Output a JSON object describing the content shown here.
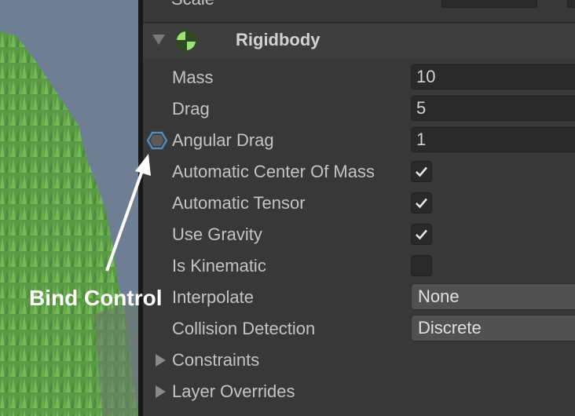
{
  "inspector": {
    "top_row_label": "Scale",
    "component": {
      "title": "Rigidbody",
      "icon": "rigidbody-icon"
    },
    "properties": [
      {
        "label": "Mass",
        "kind": "number",
        "value": "10"
      },
      {
        "label": "Drag",
        "kind": "number",
        "value": "5"
      },
      {
        "label": "Angular Drag",
        "kind": "number",
        "value": "1",
        "bound": true
      },
      {
        "label": "Automatic Center Of Mass",
        "kind": "checkbox",
        "checked": true
      },
      {
        "label": "Automatic Tensor",
        "kind": "checkbox",
        "checked": true
      },
      {
        "label": "Use Gravity",
        "kind": "checkbox",
        "checked": true
      },
      {
        "label": "Is Kinematic",
        "kind": "checkbox",
        "checked": false
      },
      {
        "label": "Interpolate",
        "kind": "dropdown",
        "value": "None"
      },
      {
        "label": "Collision Detection",
        "kind": "dropdown",
        "value": "Discrete"
      }
    ],
    "foldouts": [
      {
        "label": "Constraints"
      },
      {
        "label": "Layer Overrides"
      }
    ]
  },
  "annotation": {
    "text": "Bind Control"
  },
  "colors": {
    "panel_bg": "#383838",
    "scene_sky": "#6f7f93",
    "grass": "#5fa24a",
    "accent_icon": "#9ee07a",
    "bind_icon": "#4f8fb8"
  }
}
